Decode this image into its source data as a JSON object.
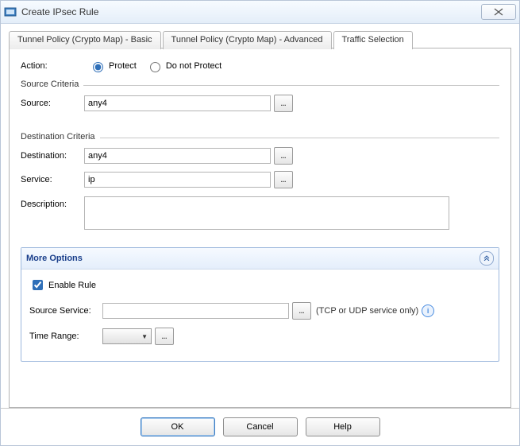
{
  "window": {
    "title": "Create IPsec Rule"
  },
  "tabs": {
    "tab1": "Tunnel Policy (Crypto Map) - Basic",
    "tab2": "Tunnel Policy (Crypto Map) - Advanced",
    "tab3": "Traffic Selection"
  },
  "action": {
    "label": "Action:",
    "protect": "Protect",
    "do_not_protect": "Do not Protect"
  },
  "source_criteria": {
    "legend": "Source Criteria",
    "source_label": "Source:",
    "source_value": "any4"
  },
  "dest_criteria": {
    "legend": "Destination Criteria",
    "dest_label": "Destination:",
    "dest_value": "any4",
    "service_label": "Service:",
    "service_value": "ip",
    "description_label": "Description:",
    "description_value": ""
  },
  "more": {
    "title": "More Options",
    "enable_rule": "Enable Rule",
    "source_service_label": "Source Service:",
    "source_service_value": "",
    "source_service_hint": "(TCP or UDP service only)",
    "time_range_label": "Time Range:"
  },
  "buttons": {
    "ok": "OK",
    "cancel": "Cancel",
    "help": "Help"
  }
}
